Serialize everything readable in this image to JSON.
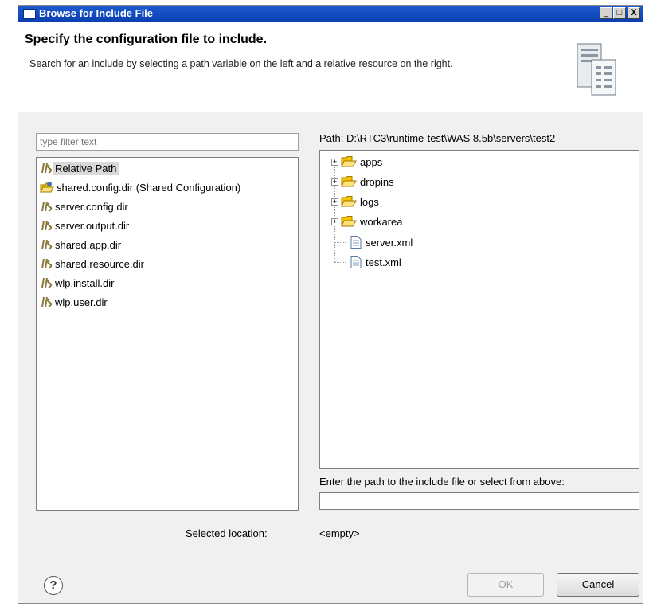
{
  "window": {
    "title": "Browse for Include File",
    "buttons": {
      "minimize": "_",
      "maximize": "□",
      "close": "X"
    }
  },
  "header": {
    "title": "Specify the configuration file to include.",
    "description": "Search for an include by selecting a path variable on the left and a relative resource on the right."
  },
  "left": {
    "filter_placeholder": "type filter text",
    "items": [
      {
        "label": "Relative Path",
        "icon": "variable-icon",
        "selected": true
      },
      {
        "label": "shared.config.dir (Shared Configuration)",
        "icon": "shared-folder-icon",
        "selected": false
      },
      {
        "label": "server.config.dir",
        "icon": "variable-icon",
        "selected": false
      },
      {
        "label": "server.output.dir",
        "icon": "variable-icon",
        "selected": false
      },
      {
        "label": "shared.app.dir",
        "icon": "variable-icon",
        "selected": false
      },
      {
        "label": "shared.resource.dir",
        "icon": "variable-icon",
        "selected": false
      },
      {
        "label": "wlp.install.dir",
        "icon": "variable-icon",
        "selected": false
      },
      {
        "label": "wlp.user.dir",
        "icon": "variable-icon",
        "selected": false
      }
    ]
  },
  "right": {
    "path_label": "Path:  D:\\RTC3\\runtime-test\\WAS 8.5b\\servers\\test2",
    "tree": [
      {
        "label": "apps",
        "type": "folder",
        "expandable": true
      },
      {
        "label": "dropins",
        "type": "folder",
        "expandable": true
      },
      {
        "label": "logs",
        "type": "folder",
        "expandable": true
      },
      {
        "label": "workarea",
        "type": "folder",
        "expandable": true
      },
      {
        "label": "server.xml",
        "type": "file",
        "expandable": false
      },
      {
        "label": "test.xml",
        "type": "file",
        "expandable": false
      }
    ],
    "enter_label": "Enter the path to the include file or select from above:",
    "path_value": ""
  },
  "selection": {
    "label": "Selected location:",
    "value": "<empty>"
  },
  "footer": {
    "help": "?",
    "ok": "OK",
    "cancel": "Cancel"
  },
  "colors": {
    "titlebar": "#0a3fb0",
    "folder": "#f5c400",
    "variable": "#8a7a3a"
  }
}
